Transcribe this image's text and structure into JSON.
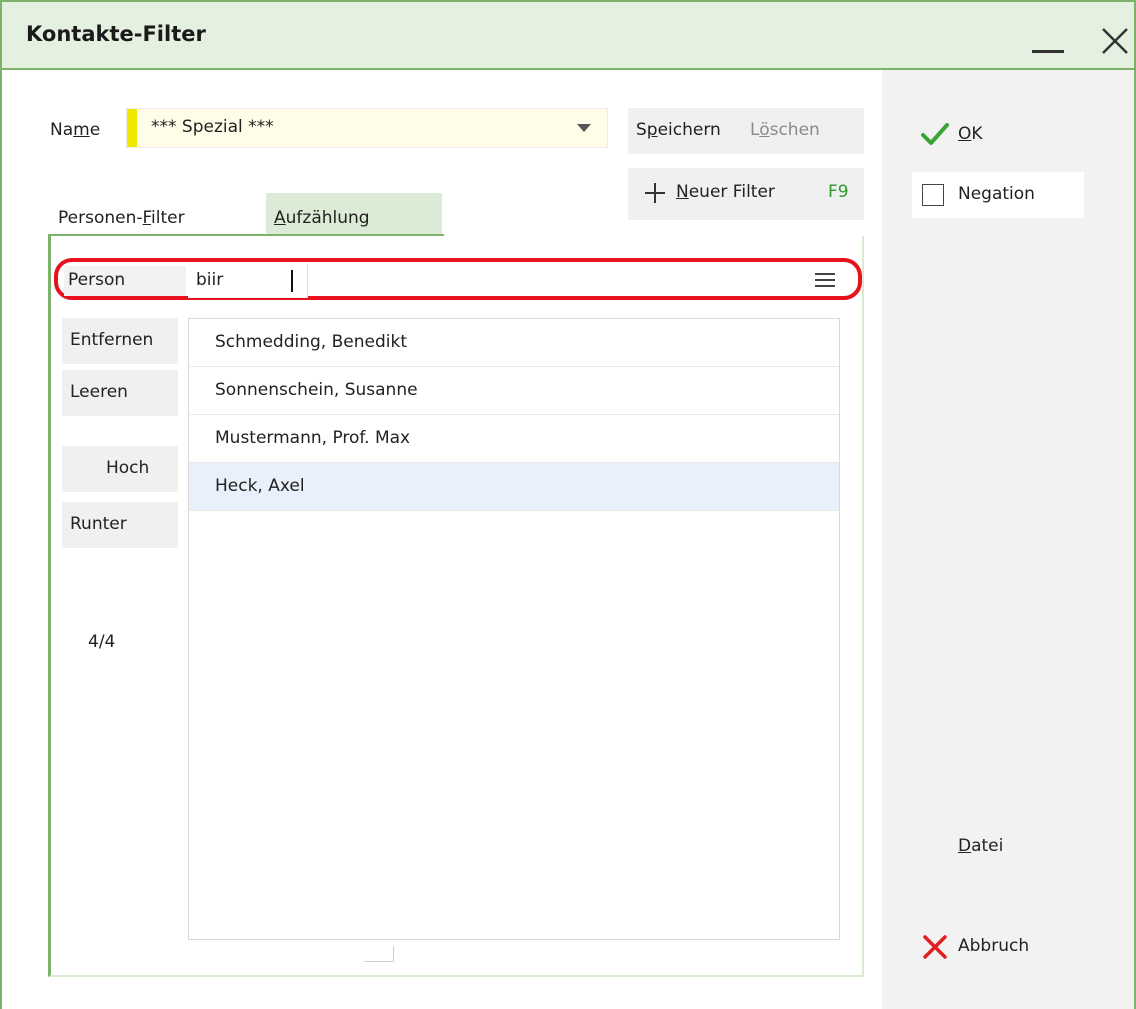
{
  "window": {
    "title": "Kontakte-Filter"
  },
  "name_field": {
    "label_prefix": "Na",
    "label_underline": "m",
    "label_suffix": "e",
    "value": "*** Spezial ***"
  },
  "toolbar": {
    "save_prefix": "S",
    "save_underline": "p",
    "save_suffix": "eichern",
    "delete_prefix": "L",
    "delete_underline": "ö",
    "delete_suffix": "schen",
    "new_filter_underline": "N",
    "new_filter_suffix": "euer Filter",
    "new_filter_shortcut": "F9"
  },
  "tabs": [
    {
      "prefix": "Personen-",
      "underline": "F",
      "suffix": "ilter",
      "active": false
    },
    {
      "prefix": "",
      "underline": "A",
      "suffix": "ufzählung",
      "active": true
    }
  ],
  "person_search": {
    "label": "Person",
    "value": "biir"
  },
  "side_buttons": {
    "remove": "Entfernen",
    "clear": "Leeren",
    "up": "Hoch",
    "down": "Runter",
    "counter": "4/4"
  },
  "list_items": [
    {
      "label": "Schmedding, Benedikt",
      "selected": false
    },
    {
      "label": "Sonnenschein, Susanne",
      "selected": false
    },
    {
      "label": "Mustermann, Prof. Max",
      "selected": false
    },
    {
      "label": "Heck, Axel",
      "selected": true
    }
  ],
  "right_panel": {
    "ok_underline": "O",
    "ok_suffix": "K",
    "negation_label": "Negation",
    "negation_checked": false,
    "file_underline": "D",
    "file_suffix": "atei",
    "cancel_label": "Abbruch"
  },
  "colors": {
    "accent_green": "#7cb26a",
    "title_bar_bg": "#e4f0e0",
    "highlight_red": "#e8121e",
    "ok_check_green": "#3aa534",
    "cancel_red": "#e0201c",
    "name_accent_yellow": "#f0e800",
    "shortcut_green": "#2e9a2a"
  },
  "icons": {
    "close": "close-icon",
    "minimize": "minimize-icon",
    "dropdown": "chevron-down-icon",
    "add": "plus-icon",
    "menu": "hamburger-menu-icon",
    "ok": "checkmark-icon",
    "cancel": "x-icon"
  }
}
